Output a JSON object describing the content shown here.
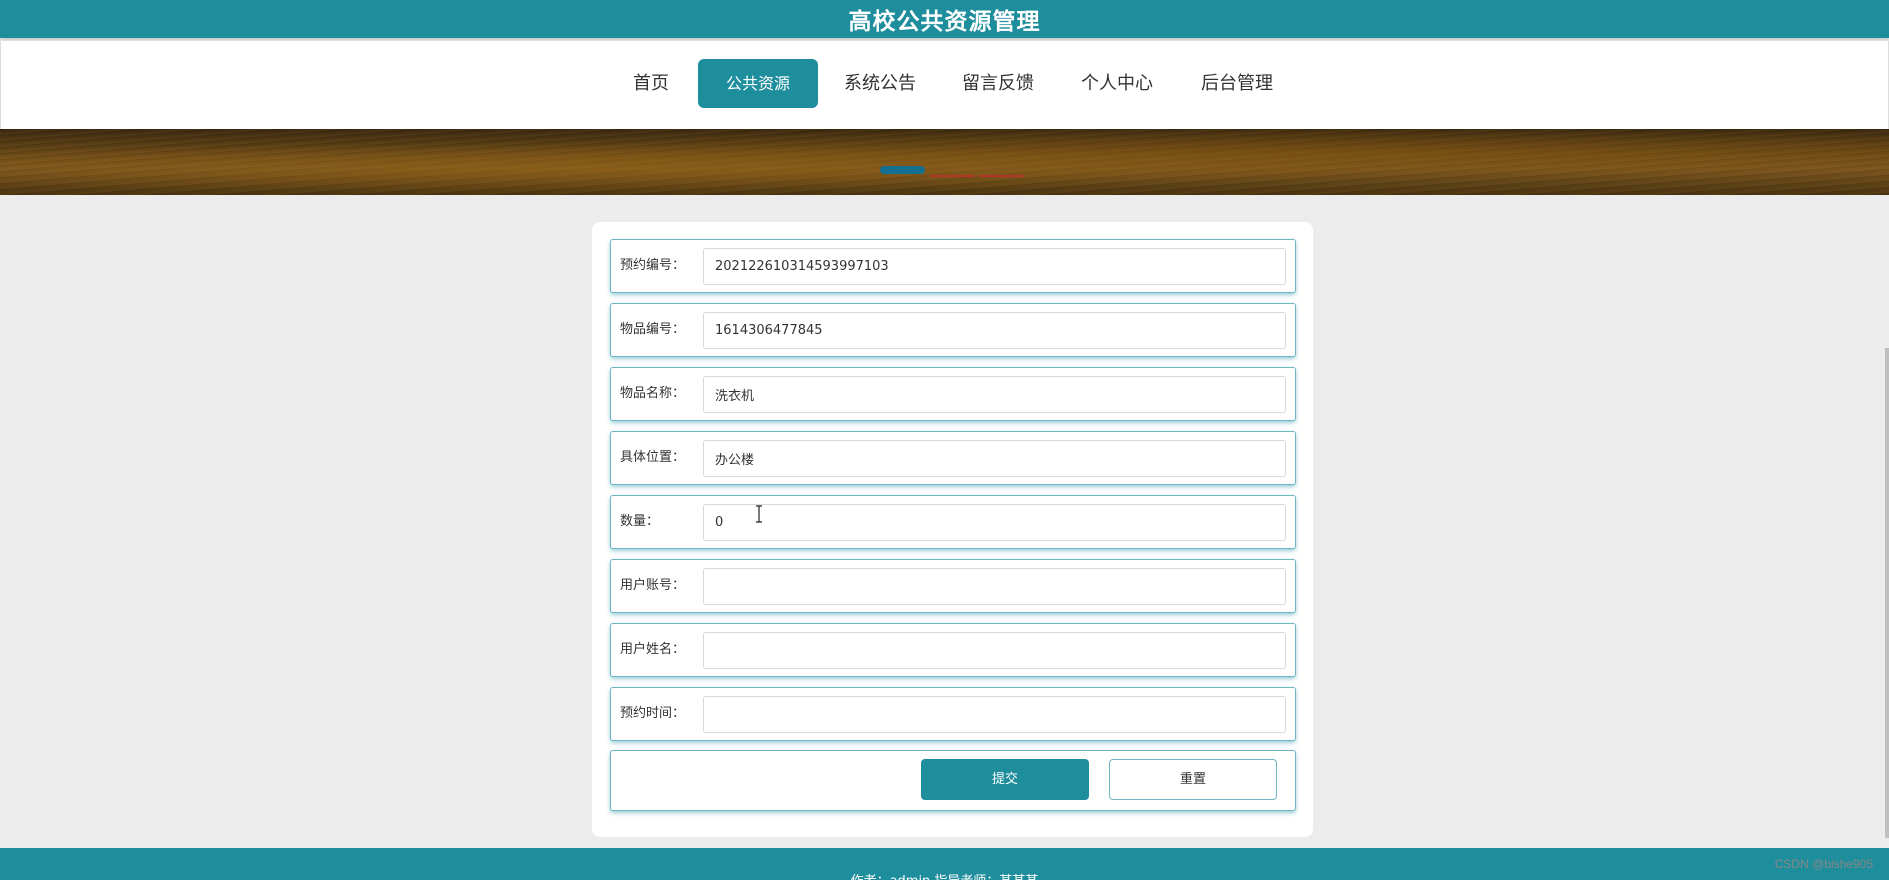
{
  "header": {
    "title": "高校公共资源管理"
  },
  "nav": {
    "items": [
      {
        "label": "首页"
      },
      {
        "label": "公共资源"
      },
      {
        "label": "系统公告"
      },
      {
        "label": "留言反馈"
      },
      {
        "label": "个人中心"
      },
      {
        "label": "后台管理"
      }
    ],
    "active_index": 1
  },
  "banner": {
    "slide_count": 3,
    "active_slide": 0
  },
  "form": {
    "fields": [
      {
        "label": "预约编号：",
        "value": "202122610314593997103",
        "placeholder": ""
      },
      {
        "label": "物品编号：",
        "value": "1614306477845",
        "placeholder": ""
      },
      {
        "label": "物品名称：",
        "value": "洗衣机",
        "placeholder": ""
      },
      {
        "label": "具体位置：",
        "value": "办公楼",
        "placeholder": ""
      },
      {
        "label": "数量：",
        "value": "0",
        "placeholder": ""
      },
      {
        "label": "用户账号：",
        "value": "",
        "placeholder": ""
      },
      {
        "label": "用户姓名：",
        "value": "",
        "placeholder": ""
      },
      {
        "label": "预约时间：",
        "value": "",
        "placeholder": ""
      }
    ],
    "submit_label": "提交",
    "reset_label": "重置"
  },
  "footer": {
    "text": "作者：admin 指导老师：某某某"
  },
  "watermark": "CSDN @bishe905",
  "colors": {
    "primary": "#1e8d9c",
    "page_bg": "#ececec",
    "dot_active": "#146f91",
    "dot_inactive": "#b8342a"
  },
  "icons": {
    "text_cursor": "text-cursor-icon"
  }
}
